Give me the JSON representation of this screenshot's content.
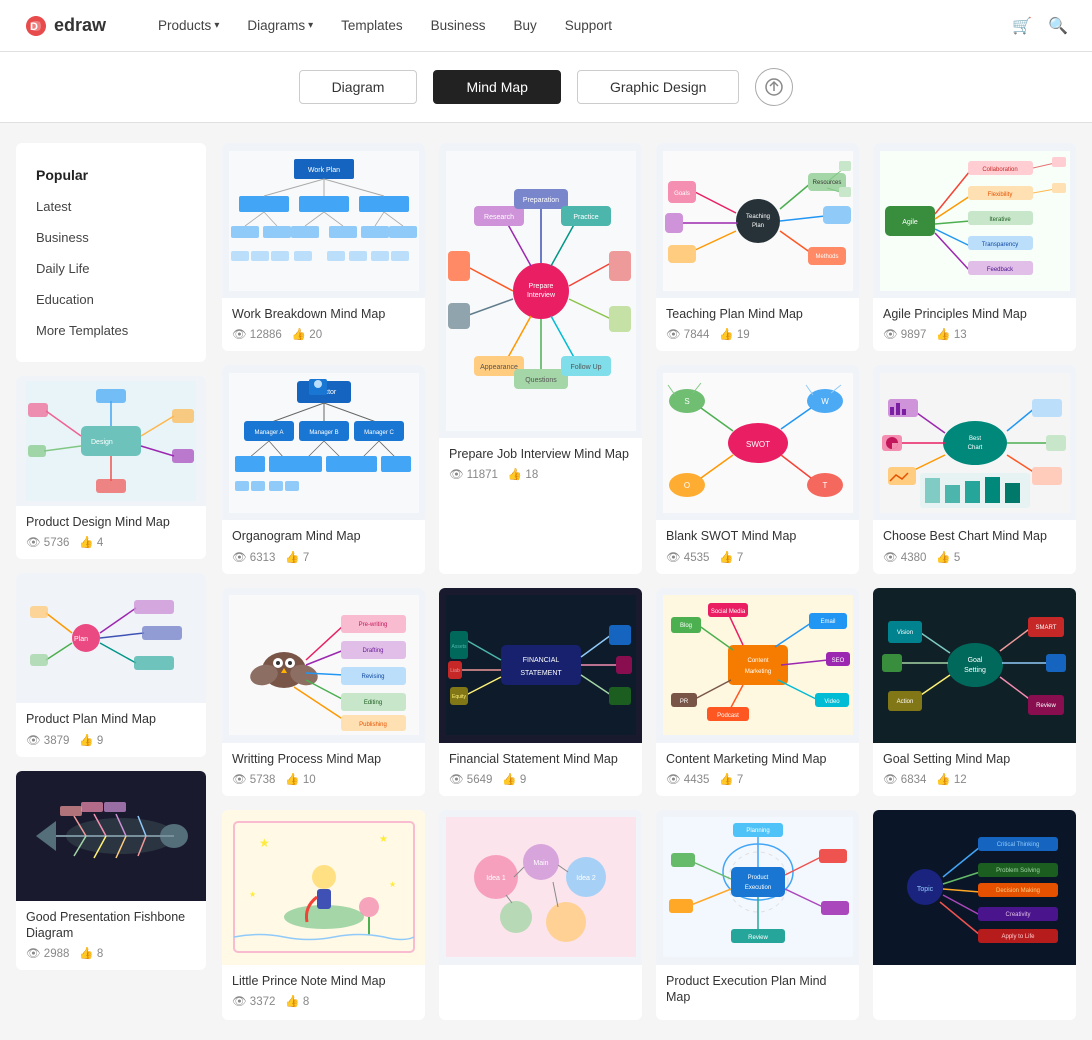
{
  "header": {
    "logo_text": "edraw",
    "nav": [
      {
        "label": "Products",
        "has_dropdown": true
      },
      {
        "label": "Diagrams",
        "has_dropdown": true
      },
      {
        "label": "Templates",
        "has_dropdown": false
      },
      {
        "label": "Business",
        "has_dropdown": false
      },
      {
        "label": "Buy",
        "has_dropdown": false
      },
      {
        "label": "Support",
        "has_dropdown": false
      }
    ]
  },
  "tabs": [
    {
      "label": "Diagram",
      "active": false
    },
    {
      "label": "Mind Map",
      "active": true
    },
    {
      "label": "Graphic Design",
      "active": false
    }
  ],
  "sidebar": {
    "items": [
      {
        "label": "Popular",
        "active": true
      },
      {
        "label": "Latest",
        "active": false
      },
      {
        "label": "Business",
        "active": false
      },
      {
        "label": "Daily Life",
        "active": false
      },
      {
        "label": "Education",
        "active": false
      },
      {
        "label": "More Templates",
        "active": false
      }
    ]
  },
  "sidebar_cards": [
    {
      "title": "Product Design Mind Map",
      "views": "5736",
      "likes": "4",
      "bg": "light"
    },
    {
      "title": "Product Plan Mind Map",
      "views": "3879",
      "likes": "9",
      "bg": "light"
    },
    {
      "title": "Good Presentation Fishbone Diagram",
      "views": "2988",
      "likes": "8",
      "bg": "dark"
    }
  ],
  "grid_cards": [
    {
      "title": "Work Breakdown Mind Map",
      "views": "12886",
      "likes": "20",
      "bg": "light",
      "col": 1
    },
    {
      "title": "Prepare Job Interview Mind Map",
      "views": "11871",
      "likes": "18",
      "bg": "light",
      "col": 2,
      "tall": true
    },
    {
      "title": "Teaching Plan Mind Map",
      "views": "7844",
      "likes": "19",
      "bg": "light",
      "col": 3
    },
    {
      "title": "Agile Principles Mind Map",
      "views": "9897",
      "likes": "13",
      "bg": "light",
      "col": 4
    },
    {
      "title": "Organogram Mind Map",
      "views": "6313",
      "likes": "7",
      "bg": "light",
      "col": 1
    },
    {
      "title": "Blank SWOT Mind Map",
      "views": "4535",
      "likes": "7",
      "bg": "light",
      "col": 2
    },
    {
      "title": "Choose Best Chart Mind Map",
      "views": "4380",
      "likes": "5",
      "bg": "light",
      "col": 3
    },
    {
      "title": "Writting Process Mind Map",
      "views": "5738",
      "likes": "10",
      "bg": "light",
      "col": 4
    },
    {
      "title": "Financial Statement Mind Map",
      "views": "5649",
      "likes": "9",
      "bg": "dark",
      "col": 1
    },
    {
      "title": "Content Marketing Mind Map",
      "views": "4435",
      "likes": "7",
      "bg": "light",
      "col": 2
    },
    {
      "title": "Goal Setting Mind Map",
      "views": "6834",
      "likes": "12",
      "bg": "dark2",
      "col": 3
    },
    {
      "title": "Little Prince Note Mind Map",
      "views": "3372",
      "likes": "8",
      "bg": "light",
      "col": 4
    },
    {
      "title": "Product Execution Plan Mind Map",
      "views": "",
      "likes": "",
      "bg": "light",
      "col": 2,
      "bottom": true
    },
    {
      "title": "",
      "views": "",
      "likes": "",
      "bg": "dark",
      "col": 3,
      "bottom": true
    }
  ],
  "icons": {
    "eye": "👁",
    "like": "👍",
    "cart": "🛒",
    "search": "🔍",
    "upload": "⬆"
  }
}
